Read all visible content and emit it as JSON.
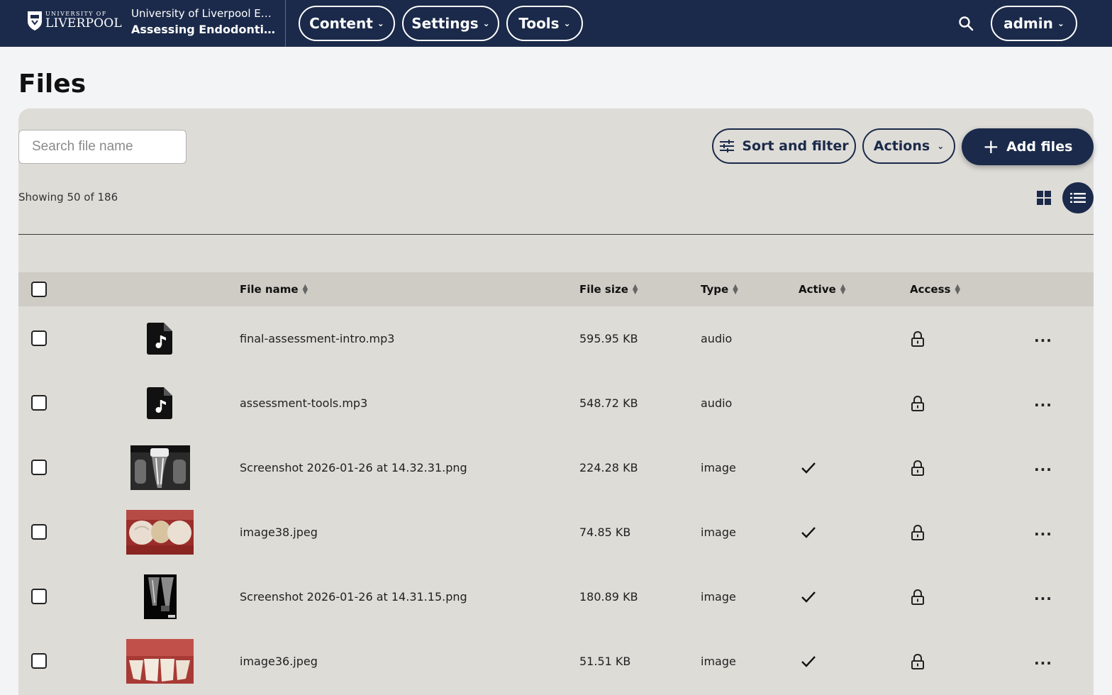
{
  "header": {
    "logo_line1": "UNIVERSITY OF",
    "logo_line2": "LIVERPOOL",
    "site_line1": "University of Liverpool EN...",
    "site_line2": "Assessing Endodonti...",
    "nav": {
      "content": "Content",
      "settings": "Settings",
      "tools": "Tools"
    },
    "user": "admin",
    "search_icon": "search-icon"
  },
  "page": {
    "title": "Files"
  },
  "toolbar": {
    "search_placeholder": "Search file name",
    "search_value": "",
    "sort_filter_label": "Sort and filter",
    "actions_label": "Actions",
    "add_files_label": "Add files"
  },
  "summary": {
    "showing": "Showing 50 of 186"
  },
  "view": {
    "mode": "list",
    "icons": [
      "grid-view-icon",
      "list-view-icon"
    ]
  },
  "table": {
    "columns": {
      "file_name": "File name",
      "file_size": "File size",
      "type": "Type",
      "active": "Active",
      "access": "Access"
    },
    "rows": [
      {
        "name": "final-assessment-intro.mp3",
        "size": "595.95 KB",
        "type": "audio",
        "active": false,
        "access": "locked",
        "thumb": "audio-file-icon"
      },
      {
        "name": "assessment-tools.mp3",
        "size": "548.72 KB",
        "type": "audio",
        "active": false,
        "access": "locked",
        "thumb": "audio-file-icon"
      },
      {
        "name": "Screenshot 2026-01-26 at 14.32.31.png",
        "size": "224.28 KB",
        "type": "image",
        "active": true,
        "access": "locked",
        "thumb": "xray-thumbnail"
      },
      {
        "name": "image38.jpeg",
        "size": "74.85 KB",
        "type": "image",
        "active": true,
        "access": "locked",
        "thumb": "teeth-photo-thumbnail"
      },
      {
        "name": "Screenshot 2026-01-26 at 14.31.15.png",
        "size": "180.89 KB",
        "type": "image",
        "active": true,
        "access": "locked",
        "thumb": "xray-thumbnail"
      },
      {
        "name": "image36.jpeg",
        "size": "51.51 KB",
        "type": "image",
        "active": true,
        "access": "locked",
        "thumb": "gums-photo-thumbnail"
      }
    ]
  },
  "colors": {
    "brand_navy": "#1b2a4a",
    "panel": "#dedcd7",
    "header_row": "#cfccc6"
  }
}
